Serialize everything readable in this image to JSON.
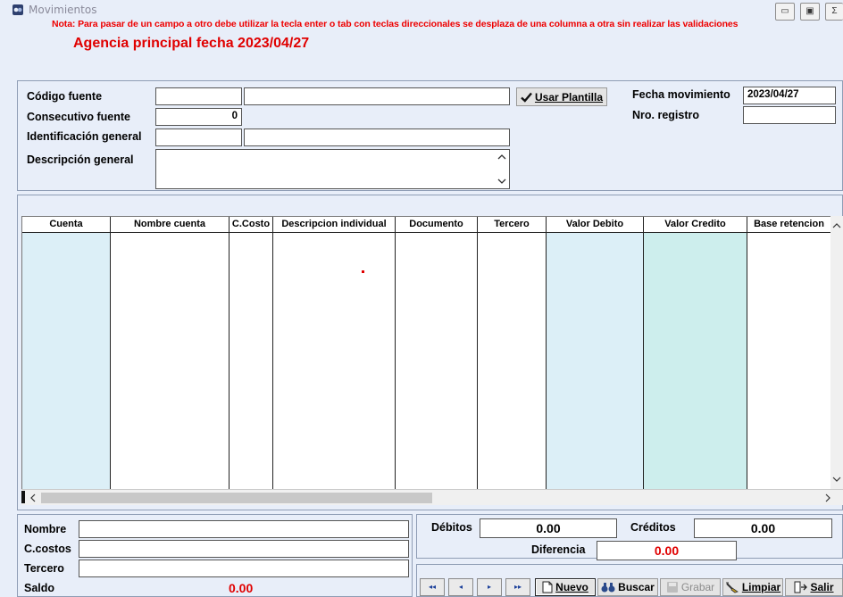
{
  "window": {
    "title": "Movimientos",
    "minimize_label": "▭",
    "maximize_label": "▣",
    "close_label": "Σ"
  },
  "note": "Nota: Para pasar de un campo a otro debe utilizar la tecla enter o tab  con teclas direccionales se desplaza de una columna  a otra sin realizar las validaciones",
  "agency_title": "Agencia principal fecha 2023/04/27",
  "form": {
    "codigo_fuente_label": "Código fuente",
    "codigo_fuente_value": "",
    "codigo_fuente_name": "",
    "consecutivo_label": "Consecutivo fuente",
    "consecutivo_value": "0",
    "identificacion_label": "Identificación general",
    "identificacion_value": "",
    "identificacion_name": "",
    "descripcion_label": "Descripción general",
    "descripcion_value": "",
    "usar_plantilla_label": "Usar Plantilla",
    "fecha_label": "Fecha movimiento",
    "fecha_value": "2023/04/27",
    "registro_label": "Nro. registro",
    "registro_value": ""
  },
  "grid": {
    "columns": [
      "Cuenta",
      "Nombre cuenta",
      "C.Costo",
      "Descripcion individual",
      "Documento",
      "Tercero",
      "Valor Debito",
      "Valor Credito",
      "Base retencion"
    ],
    "rows": []
  },
  "bottom": {
    "nombre_label": "Nombre",
    "nombre_value": "",
    "ccostos_label": "C.costos",
    "ccostos_value": "",
    "tercero_label": "Tercero",
    "tercero_value": "",
    "saldo_label": "Saldo",
    "saldo_value": "0.00",
    "debitos_label": "Débitos",
    "debitos_value": "0.00",
    "creditos_label": "Créditos",
    "creditos_value": "0.00",
    "diferencia_label": "Diferencia",
    "diferencia_value": "0.00"
  },
  "toolbar": {
    "first_label": "◂◂",
    "prev_label": "◂",
    "next_label": "▸",
    "last_label": "▸▸",
    "nuevo_label": "Nuevo",
    "buscar_label": "Buscar",
    "grabar_label": "Grabar",
    "limpiar_label": "Limpiar",
    "salir_label": "Salir"
  },
  "colors": {
    "accent_red": "#e00000",
    "window_bg": "#e8eef9",
    "grid_tint_blue": "#dceff7",
    "grid_tint_teal": "#cdeeed"
  }
}
